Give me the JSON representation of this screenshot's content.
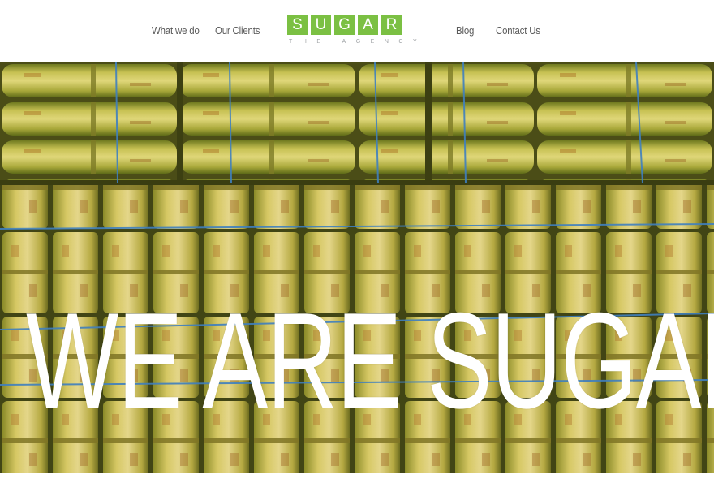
{
  "nav": {
    "what_we_do": "What we do",
    "our_clients": "Our Clients",
    "blog": "Blog",
    "contact_us": "Contact Us"
  },
  "logo": {
    "letters": [
      "S",
      "U",
      "G",
      "A",
      "R"
    ],
    "tagline": "THE AGENCY",
    "color": "#7bc043"
  },
  "hero": {
    "title": "WE ARE SUGAR",
    "background_subject": "bundled sugarcane stalks tied with blue string"
  },
  "colors": {
    "accent": "#7bc043",
    "nav_text": "#5a5a5a",
    "tagline": "#9fa3a6"
  }
}
